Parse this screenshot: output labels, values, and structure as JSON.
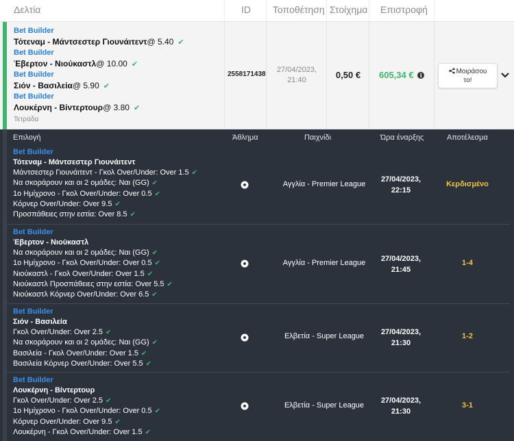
{
  "columns": {
    "slips": "Δελτία",
    "id": "ID",
    "placement": "Τοποθέτηση",
    "stake": "Στοίχημα",
    "return": "Επιστροφή"
  },
  "slip": {
    "selections": [
      {
        "tag": "Bet Builder",
        "event": "Τότεναμ - Μάντσεστερ Γιουνάιτεντ",
        "odds": "@ 5.40"
      },
      {
        "tag": "Bet Builder",
        "event": "Έβερτον - Νιούκαστλ",
        "odds": "@ 10.00"
      },
      {
        "tag": "Bet Builder",
        "event": "Σιόν - Βασιλεία",
        "odds": "@ 5.90"
      },
      {
        "tag": "Bet Builder",
        "event": "Λουκέρνη - Βίντερτουρ",
        "odds": "@ 3.80"
      }
    ],
    "bet_type": "Τετράδα",
    "bet_id": "2558171438",
    "placed_date": "27/04/2023,",
    "placed_time": "21:40",
    "stake": "0,50 €",
    "return": "605,34 €",
    "share_line1": "Μοιράσου",
    "share_line2": "το!"
  },
  "details_columns": {
    "selection": "Επιλογή",
    "sport": "Άθλημα",
    "game": "Παιχνίδι",
    "start": "Ώρα έναρξης",
    "result": "Αποτέλεσμα"
  },
  "details": [
    {
      "tag": "Bet Builder",
      "event": "Τότεναμ - Μάντσεστερ Γιουνάιτεντ",
      "legs": [
        "Μάντσεστερ Γιουνάιτεντ - Γκολ Over/Under: Over 1.5",
        "Να σκοράρουν και οι 2 ομάδες: Ναι (GG)",
        "1ο Ημίχρονο - Γκολ Over/Under: Over 0.5",
        "Κόρνερ Over/Under: Over 9.5",
        "Προσπάθειες στην εστία: Over 8.5"
      ],
      "league": "Αγγλία - Premier League",
      "date": "27/04/2023,",
      "time": "22:15",
      "result": "Κερδισμένο"
    },
    {
      "tag": "Bet Builder",
      "event": "Έβερτον - Νιούκαστλ",
      "legs": [
        "Να σκοράρουν και οι 2 ομάδες: Ναι (GG)",
        "1ο Ημίχρονο - Γκολ Over/Under: Over 0.5",
        "Νιούκαστλ - Γκολ Over/Under: Over 1.5",
        "Νιούκαστλ Προσπάθειες στην εστία: Over 5.5",
        "Νιούκαστλ Κόρνερ Over/Under: Over 6.5"
      ],
      "league": "Αγγλία - Premier League",
      "date": "27/04/2023,",
      "time": "21:45",
      "result": "1-4"
    },
    {
      "tag": "Bet Builder",
      "event": "Σιόν - Βασιλεία",
      "legs": [
        "Γκολ Over/Under: Over 2.5",
        "Να σκοράρουν και οι 2 ομάδες: Ναι (GG)",
        "Βασιλεία - Γκολ Over/Under: Over 1.5",
        "Βασιλεία Κόρνερ Over/Under: Over 5.5"
      ],
      "league": "Ελβετία - Super League",
      "date": "27/04/2023,",
      "time": "21:30",
      "result": "1-2"
    },
    {
      "tag": "Bet Builder",
      "event": "Λουκέρνη - Βίντερτουρ",
      "legs": [
        "Γκολ Over/Under: Over 2.5",
        "1ο Ημίχρονο - Γκολ Over/Under: Over 0.5",
        "Κόρνερ Over/Under: Over 9.5",
        "Λουκέρνη - Γκολ Over/Under: Over 1.5"
      ],
      "league": "Ελβετία - Super League",
      "date": "27/04/2023,",
      "time": "21:30",
      "result": "3-1"
    }
  ],
  "icons": {
    "check": "check-icon",
    "sport": "football-icon",
    "share": "share-icon",
    "expand": "chevron-down-icon",
    "info": "info-icon"
  },
  "colors": {
    "accent_blue": "#2a7fd6",
    "win_green": "#3fb46b",
    "result_yellow": "#f0c43c",
    "dark_panel": "#2c323b"
  }
}
